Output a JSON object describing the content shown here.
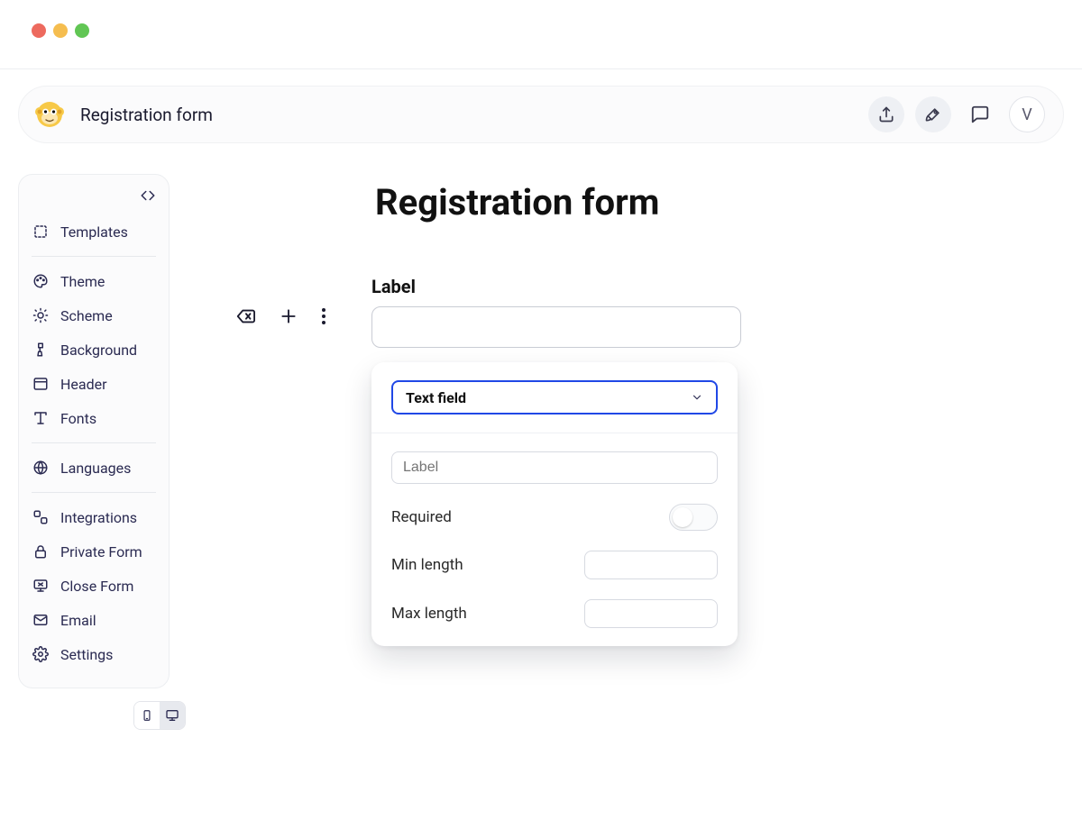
{
  "header": {
    "title": "Registration form",
    "avatar_initial": "V"
  },
  "sidebar": {
    "items": [
      {
        "label": "Templates"
      },
      {
        "label": "Theme"
      },
      {
        "label": "Scheme"
      },
      {
        "label": "Background"
      },
      {
        "label": "Header"
      },
      {
        "label": "Fonts"
      },
      {
        "label": "Languages"
      },
      {
        "label": "Integrations"
      },
      {
        "label": "Private Form"
      },
      {
        "label": "Close Form"
      },
      {
        "label": "Email"
      },
      {
        "label": "Settings"
      }
    ]
  },
  "canvas": {
    "form_title": "Registration form",
    "field_label": "Label",
    "field_value": ""
  },
  "popover": {
    "type_selected": "Text field",
    "label_placeholder": "Label",
    "required_label": "Required",
    "required_on": false,
    "min_length_label": "Min length",
    "min_length_value": "",
    "max_length_label": "Max length",
    "max_length_value": ""
  },
  "colors": {
    "accent": "#2048e6"
  }
}
